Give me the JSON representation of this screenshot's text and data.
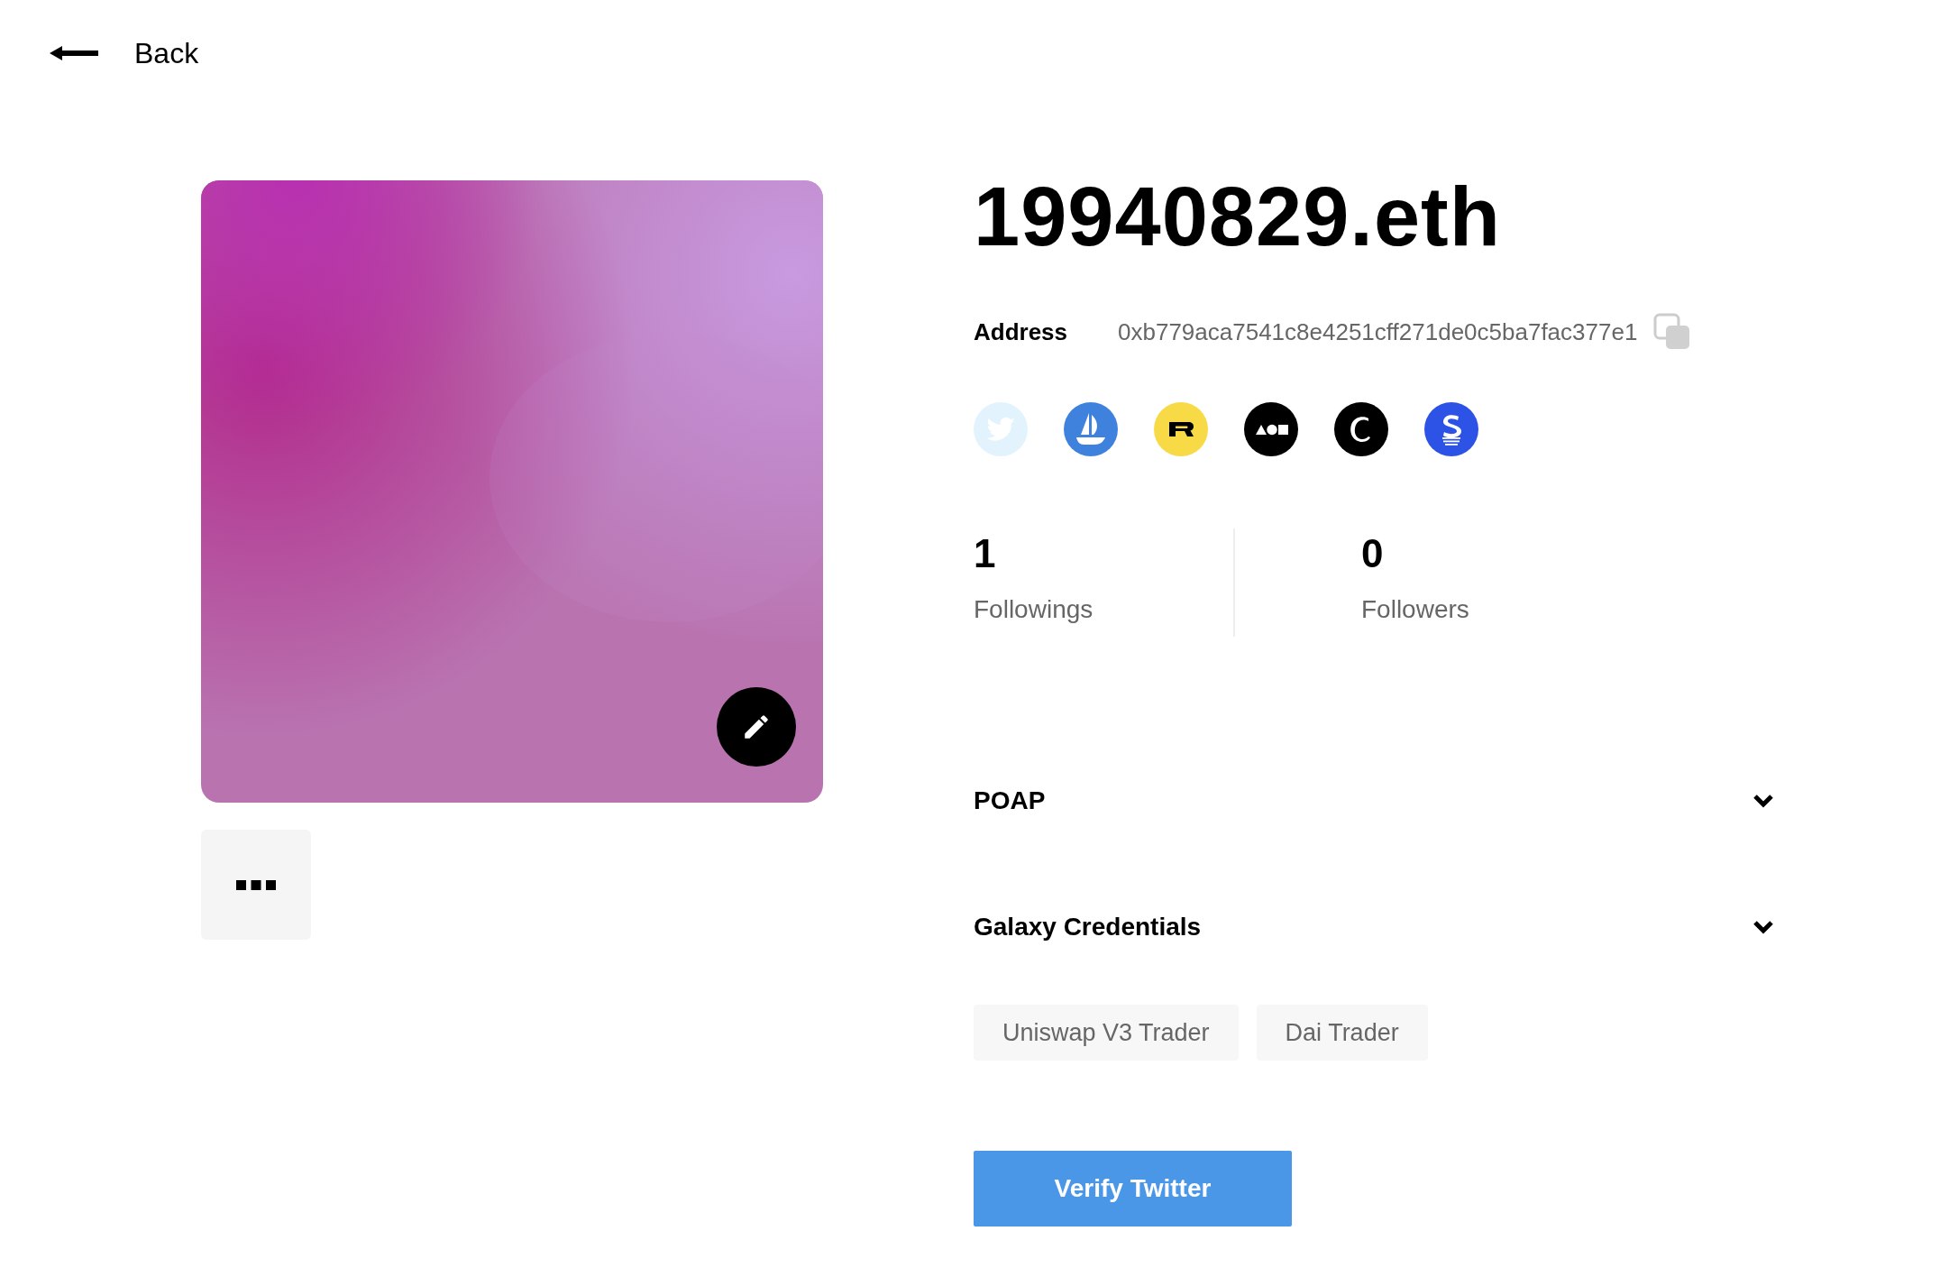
{
  "back": {
    "label": "Back"
  },
  "profile": {
    "name": "19940829.eth",
    "address_label": "Address",
    "address": "0xb779aca7541c8e4251cff271de0c5ba7fac377e1"
  },
  "social_links": [
    {
      "kind": "twitter",
      "linked": false
    },
    {
      "kind": "opensea",
      "linked": true
    },
    {
      "kind": "rarible",
      "linked": true
    },
    {
      "kind": "foundation",
      "linked": true
    },
    {
      "kind": "context",
      "linked": true
    },
    {
      "kind": "superrare",
      "linked": true
    }
  ],
  "stats": [
    {
      "value": "1",
      "label": "Followings"
    },
    {
      "value": "0",
      "label": "Followers"
    }
  ],
  "sections": [
    {
      "title": "POAP",
      "expanded": false
    },
    {
      "title": "Galaxy Credentials",
      "expanded": false,
      "tags": [
        "Uniswap V3 Trader",
        "Dai Trader"
      ]
    }
  ],
  "verify_button": {
    "label": "Verify Twitter"
  }
}
